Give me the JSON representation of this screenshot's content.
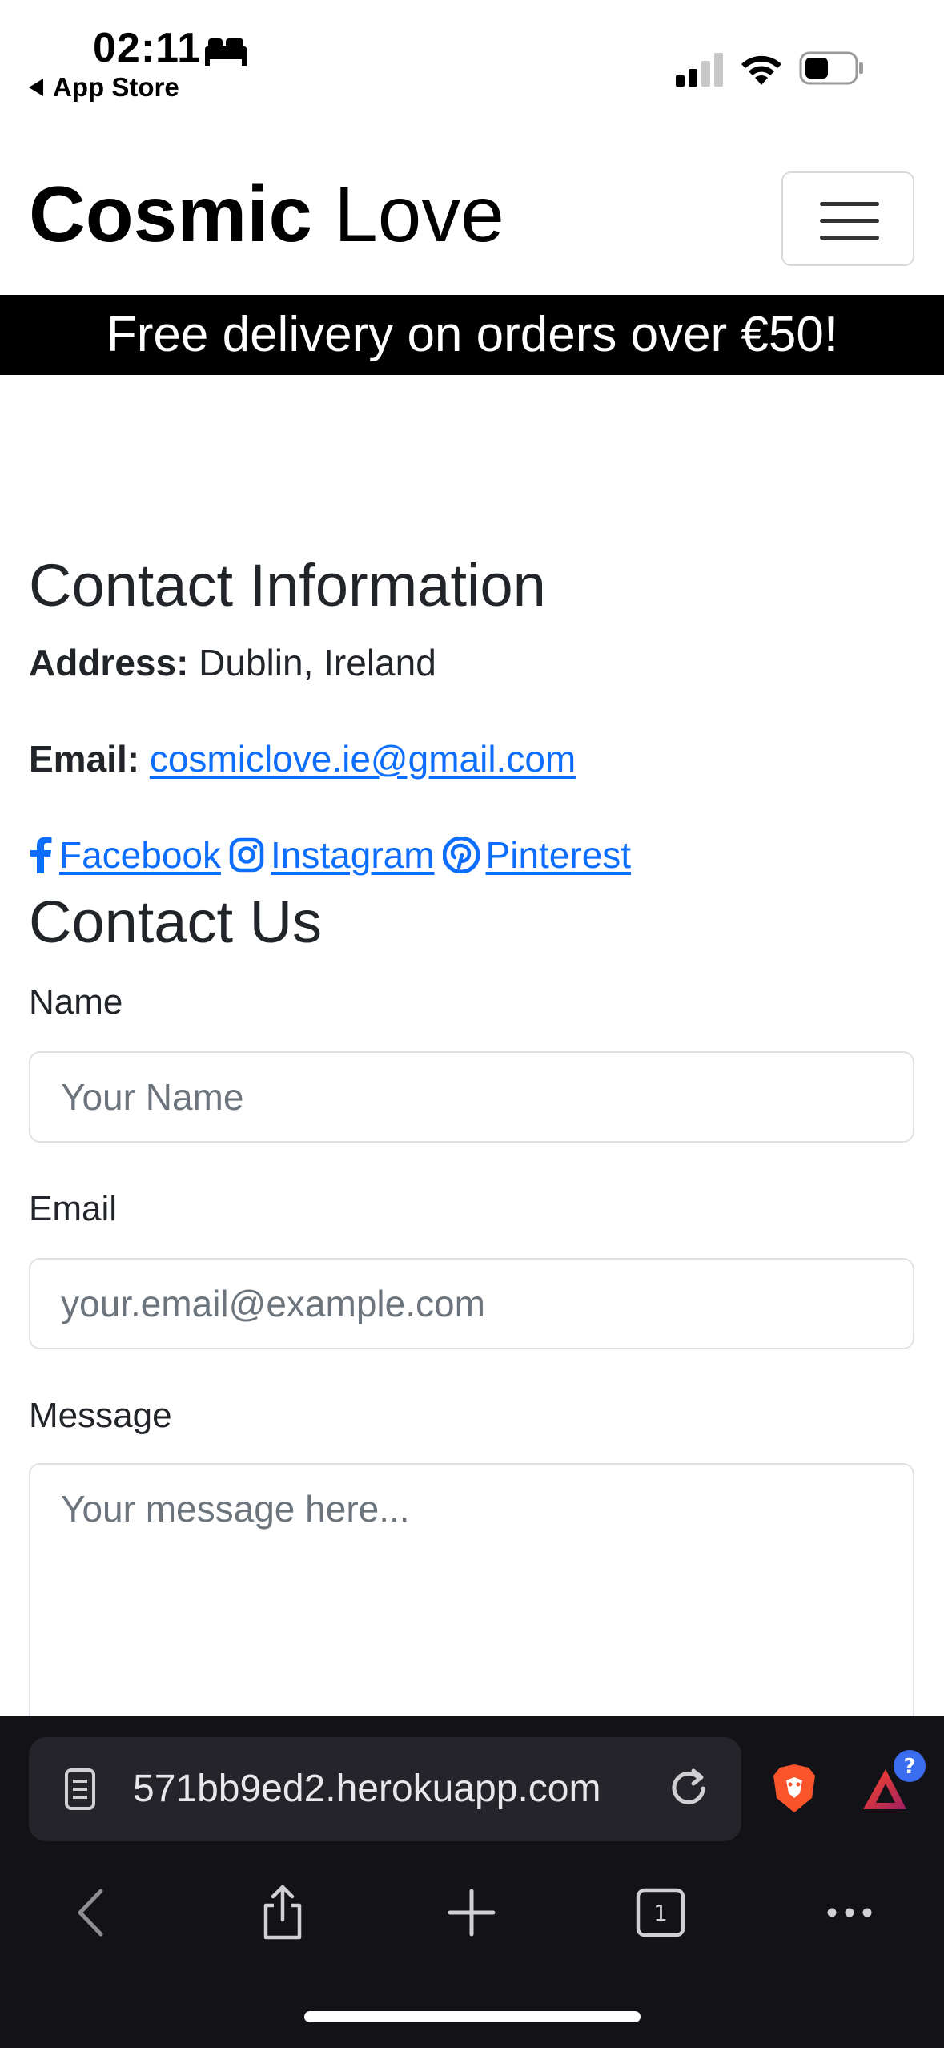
{
  "status_bar": {
    "time": "02:11",
    "back_label": "App Store"
  },
  "navbar": {
    "brand_bold": "Cosmic",
    "brand_light": "Love"
  },
  "banner": {
    "text": "Free delivery on orders over €50!"
  },
  "contact_info": {
    "heading": "Contact Information",
    "address_label": "Address:",
    "address_value": "Dublin, Ireland",
    "email_label": "Email:",
    "email_value": "cosmiclove.ie@gmail.com",
    "social": [
      {
        "label": "Facebook",
        "icon": "facebook-icon"
      },
      {
        "label": "Instagram",
        "icon": "instagram-icon"
      },
      {
        "label": "Pinterest",
        "icon": "pinterest-icon"
      }
    ]
  },
  "contact_form": {
    "heading": "Contact Us",
    "name_label": "Name",
    "name_placeholder": "Your Name",
    "email_label": "Email",
    "email_placeholder": "your.email@example.com",
    "message_label": "Message",
    "message_placeholder": "Your message here..."
  },
  "browser": {
    "url": "571bb9ed2.herokuapp.com",
    "tab_count": "1",
    "rewards_badge": "?"
  },
  "colors": {
    "link": "#0d6efd",
    "banner_bg": "#000000",
    "browser_bar": "#131317"
  }
}
